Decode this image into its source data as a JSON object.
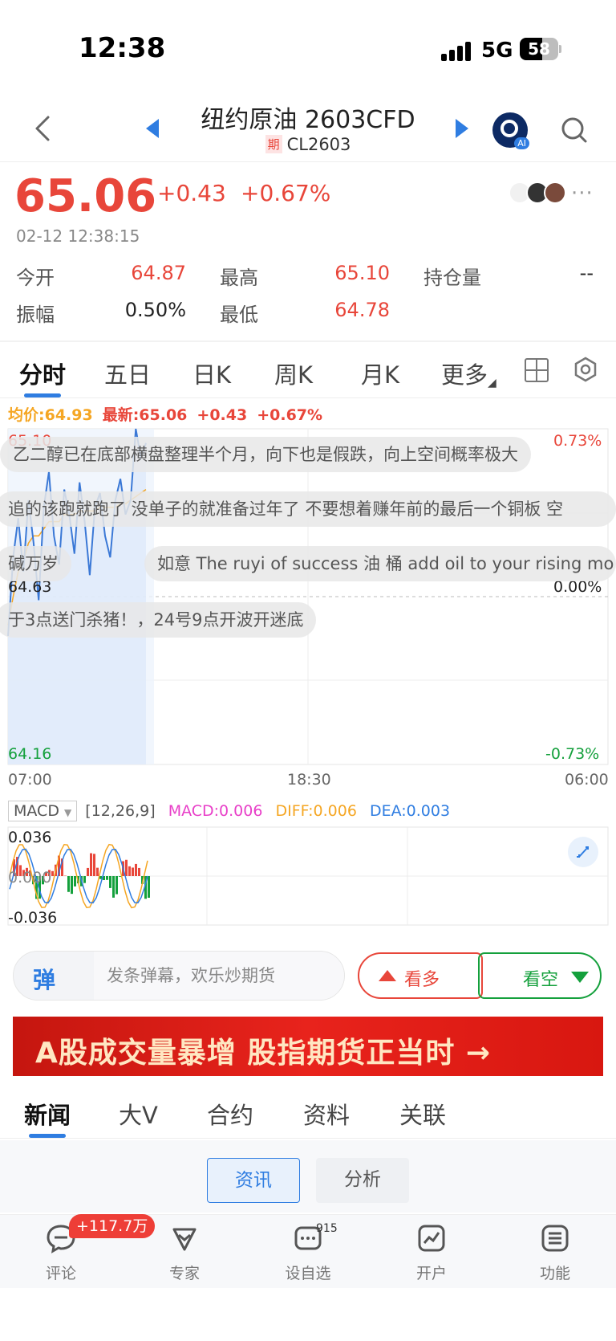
{
  "status_bar": {
    "time": "12:38",
    "network": "5G",
    "battery": "58"
  },
  "header": {
    "title": "纽约原油 2603CFD",
    "badge": "期",
    "code": "CL2603",
    "ai_label": "AI"
  },
  "quote": {
    "price": "65.06",
    "change": "+0.43",
    "change_pct": "+0.67%",
    "timestamp": "02-12 12:38:15",
    "stats": [
      {
        "label": "今开",
        "value": "64.87",
        "color": "#e8463a"
      },
      {
        "label": "最高",
        "value": "65.10",
        "color": "#e8463a"
      },
      {
        "label": "持仓量",
        "value": "--",
        "color": "#222222"
      },
      {
        "label": "振幅",
        "value": "0.50%",
        "color": "#222222"
      },
      {
        "label": "最低",
        "value": "64.78",
        "color": "#e8463a"
      }
    ],
    "more": "···"
  },
  "tabs": [
    "分时",
    "五日",
    "日K",
    "周K",
    "月K",
    "更多"
  ],
  "chart_legend": {
    "avg": "均价:64.93",
    "latest": "最新:65.06",
    "change": "+0.43",
    "pct": "+0.67%"
  },
  "chart_axes": {
    "y_top": "65.10",
    "y_mid": "64.63",
    "y_bottom": "64.16",
    "pct_top": "0.73%",
    "pct_mid": "0.00%",
    "pct_bottom": "-0.73%",
    "x_labels": [
      "07:00",
      "18:30",
      "06:00"
    ]
  },
  "chart_data": {
    "type": "line",
    "series": [
      {
        "values": [
          64.52,
          64.74,
          64.85,
          64.7,
          64.9,
          64.78,
          64.62,
          64.88,
          64.98,
          64.8,
          64.72,
          64.93,
          64.86,
          64.75,
          64.95,
          64.84,
          64.69,
          64.88,
          64.92,
          64.8,
          64.74,
          64.9,
          64.96,
          64.86,
          64.9,
          65.1,
          65.02,
          65.06
        ]
      },
      {
        "values": [
          64.55,
          64.63,
          64.7,
          64.73,
          64.78,
          64.8,
          64.8,
          64.82,
          64.84,
          64.84,
          64.84,
          64.86,
          64.86,
          64.86,
          64.87,
          64.87,
          64.87,
          64.87,
          64.88,
          64.88,
          64.88,
          64.88,
          64.89,
          64.89,
          64.9,
          64.91,
          64.92,
          64.93
        ]
      }
    ],
    "ylim": [
      64.16,
      65.1
    ],
    "reference": 64.63,
    "x_labels": [
      "07:00",
      "18:30",
      "06:00"
    ]
  },
  "danmu": [
    "乙二醇已在底部横盘整理半个月，向下也是假跌，向上空间概率极大",
    "追的该跑就跑了 没单子的就准备过年了  不要想着赚年前的最后一个铜板  空",
    "碱万岁",
    "如意 The ruyi of success 油 桶 add oil to your rising mo",
    "于3点送门杀猪！，24号9点开波开迷底"
  ],
  "macd": {
    "indicator": "MACD",
    "params": "[12,26,9]",
    "macd": "MACD:0.006",
    "diff": "DIFF:0.006",
    "dea": "DEA:0.003",
    "y_top": "0.036",
    "y_mid": "0.000",
    "y_bottom": "-0.036",
    "colors": {
      "macd": "#e83fc8",
      "diff": "#f5a623",
      "dea": "#2f7de1"
    }
  },
  "input": {
    "icon_label": "弹",
    "placeholder": "发条弹幕，欢乐炒期货"
  },
  "vote": {
    "bull": "看多",
    "bear": "看空"
  },
  "banner": {
    "text": "A股成交量暴增 股指期货正当时 →"
  },
  "news_tabs": [
    "新闻",
    "大V",
    "合约",
    "资料",
    "关联"
  ],
  "sub_tabs": [
    "资讯",
    "分析"
  ],
  "bottom_nav": [
    {
      "label": "评论",
      "icon": "comment-icon"
    },
    {
      "label": "专家",
      "icon": "expert-icon"
    },
    {
      "label": "设自选",
      "icon": "add-watchlist-icon"
    },
    {
      "label": "开户",
      "icon": "open-account-icon"
    },
    {
      "label": "功能",
      "icon": "menu-icon"
    }
  ],
  "badges": {
    "comments": "+117.7万",
    "watchlist": "915"
  },
  "colors": {
    "up": "#e8463a",
    "down": "#14a03c",
    "accent": "#2f7de1",
    "price_line": "#3a78d6",
    "avg_line": "#f5a623"
  }
}
